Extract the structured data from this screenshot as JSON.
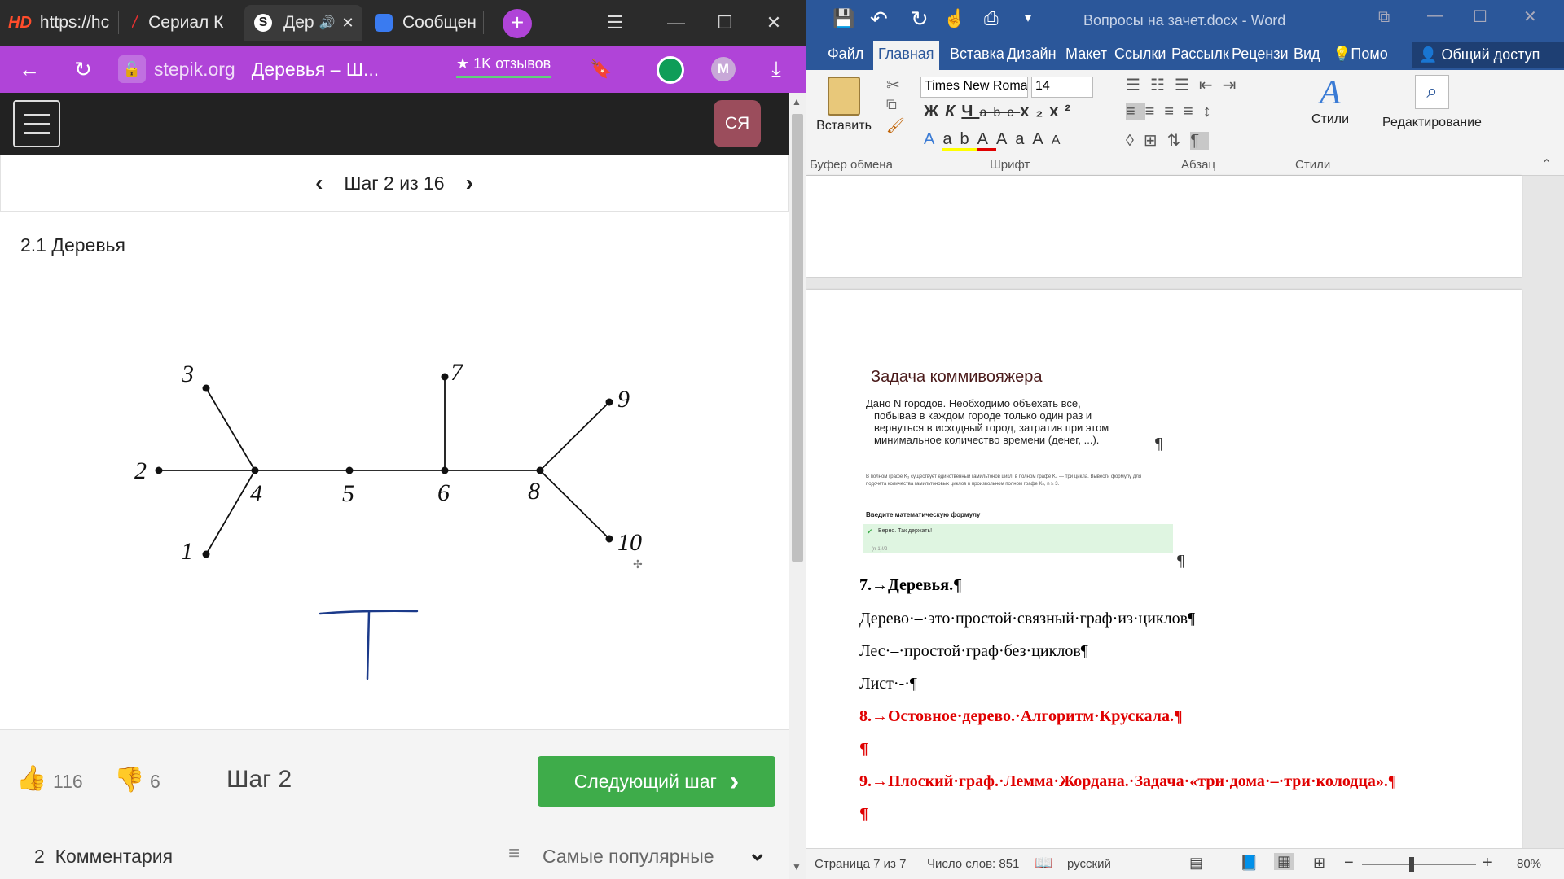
{
  "browser": {
    "tabs": [
      {
        "label": "https://hc",
        "icon": "hd-icon"
      },
      {
        "label": "Сериал К",
        "icon": "serial-icon"
      },
      {
        "label": "Дер",
        "icon": "stepik-icon"
      },
      {
        "label": "Сообщен",
        "icon": "messenger-icon"
      }
    ],
    "address": {
      "domain": "stepik.org",
      "page_title": "Деревья – Ш...",
      "reviews": "★ 1K отзывов"
    },
    "avatar_letter": "M"
  },
  "stepik": {
    "user_initials": "СЯ",
    "step_label": "Шаг 2 из 16",
    "lesson_title": "2.1 Деревья",
    "likes": "116",
    "dislikes": "6",
    "step_short": "Шаг 2",
    "next_button": "Следующий шаг",
    "comments": "2  Комментария",
    "sort_label": "Самые популярные",
    "graph_labels": [
      "1",
      "2",
      "3",
      "4",
      "5",
      "6",
      "7",
      "8",
      "9",
      "10"
    ]
  },
  "word": {
    "window_title": "Вопросы на зачет.docx - Word",
    "tabs": [
      "Файл",
      "Главная",
      "Вставка",
      "Дизайн",
      "Макет",
      "Ссылки",
      "Рассылк",
      "Рецензи",
      "Вид",
      "Помо"
    ],
    "share": "Общий доступ",
    "font_name": "Times New Romar",
    "font_size": "14",
    "paste": "Вставить",
    "styles": "Стили",
    "editing": "Редактирование",
    "groups": [
      "Буфер обмена",
      "Шрифт",
      "Абзац",
      "Стили"
    ],
    "embedded": {
      "title": "Задача коммивояжера",
      "text_lines": [
        "Дано N городов. Необходимо объехать все,",
        "побывав в каждом городе только один раз и",
        "вернуться в исходный город, затратив при этом",
        "минимальное количество времени (денег, ...)."
      ],
      "small_line1": "В полном графе K₃ существует единственный гамильтонов цикл, в полном графе K₄ — три цикла. Вывести формулу для",
      "small_line2": "подсчета количества гамильтоновых циклов в произвольном полном графе Kₙ, n ≥ 3.",
      "formula_label": "Введите математическую формулу",
      "correct": "Верно. Так держать!",
      "answer": "(n-1)!/2"
    },
    "doc_lines": [
      {
        "text": "7.→Деревья.¶",
        "bold": true,
        "color": "#000000"
      },
      {
        "text": "Дерево·–·это·простой·связный·граф·из·циклов¶",
        "bold": false,
        "color": "#000000"
      },
      {
        "text": "Лес·–·простой·граф·без·циклов¶",
        "bold": false,
        "color": "#000000"
      },
      {
        "text": "Лист·-·¶",
        "bold": false,
        "color": "#000000"
      },
      {
        "text": "8.→Остовное·дерево.·Алгоритм·Крускала.¶",
        "bold": true,
        "color": "#e00000"
      },
      {
        "text": "¶",
        "bold": true,
        "color": "#e00000"
      },
      {
        "text": "9.→Плоский·граф.·Лемма·Жордана.·Задача·«три·дома·–·три·колодца».¶",
        "bold": true,
        "color": "#e00000"
      },
      {
        "text": "¶",
        "bold": true,
        "color": "#e00000"
      }
    ],
    "status": {
      "page": "Страница 7 из 7",
      "words": "Число слов: 851",
      "lang": "русский",
      "zoom": "80%"
    }
  },
  "colors": {
    "stepik_purple": "#b044d8",
    "word_blue": "#2b579a",
    "next_green": "#3eac4a",
    "avatar_red": "#9b4d5c"
  }
}
